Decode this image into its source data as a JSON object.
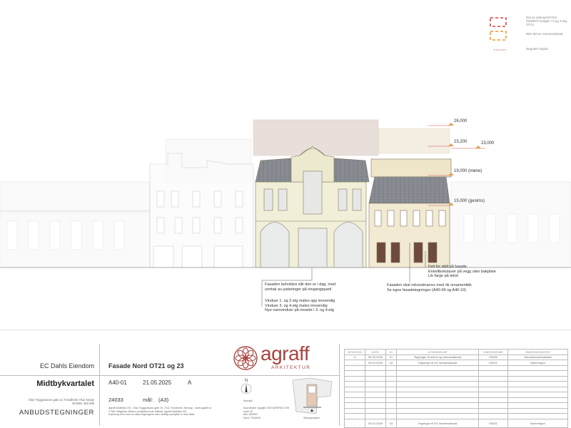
{
  "legend": {
    "item1": "Del av søknad BYGG-25/80970 boliger i 3.og 4.etg. OT21",
    "item2": "Ikke del av rammesøknad",
    "item3": "Regulert høyde"
  },
  "elevations": {
    "e1": "26,000",
    "e2": "23,200",
    "e3": "23,000",
    "e4": "19,000 (møne)",
    "e5": "15,000 (gesims)"
  },
  "notes": {
    "sign": [
      "Felt for skilt på fasade.",
      "Enkeltbokstaver på vegg uten bakplate",
      "Lik farge på tekst"
    ],
    "ot23": [
      "Fasaden skal rekonstrueres med rik ornamentikk",
      "Se egne fasadetegninger (A40-09 og A40-10)"
    ],
    "ot21": [
      "Fasaden beholdes slik den er i dag, med",
      "unntak av justeringer på inngangsparti"
    ],
    "windows": [
      "Vinduer 1. og 2.etg males opp innvendig",
      "Vinduer 3. og 4.etg males innvendig",
      "Nye varevinduer på innside i 3. og 4.etg"
    ]
  },
  "titleblock": {
    "client": "EC Dahls Eiendom",
    "project": "Midtbykvartalet",
    "address": [
      "Olav Tryggvasons gate 21 Trondheim 7011 Norge",
      "Gnr/Bnr 401/189"
    ],
    "phase": "ANBUDSTEGNINGER",
    "drawing_title": "Fasade Nord OT21 og 23",
    "drawing_no": "A40-01",
    "date": "21.05.2025",
    "revision": "A",
    "project_no": "24033",
    "scale_label": "mål:",
    "scale": "(A3)",
    "firm_lines": [
      "Agraff Arkitektur AS - Olav Tryggvasons gate 19, 7011 Trondheim, Norway - www.agraff.no",
      "© Alle rettigheter tilhører prosjekterende arkitekt, Agraff Arkitektur AS.",
      "Kopiering eller bruk av disse tegningene uten skriftlig samtykke er ikke tillatt."
    ],
    "brand": "agraff",
    "brand_sub": "ARKITEKTUR",
    "north_label": "Nordpil",
    "coords": [
      "Koordinater oppgitt i NS EUREF89 UTM sone 32",
      "Øst: 569900",
      "Nord: 7034349"
    ],
    "keyplan_label": "Situasjonsplan"
  },
  "revisions": {
    "headers": [
      "REVISJON",
      "DATO",
      "ID",
      "UTSENDELSE",
      "ENDRINGSNR",
      "ENDRINGSNOTAT"
    ],
    "rows": [
      [
        "A",
        "06.05.2025",
        "07",
        "Tegninger til anbud og rammesøknad",
        "FA006",
        "Anbud/rammesøknad"
      ],
      [
        "-",
        "03.02.2025",
        "03",
        "Tegninger til KS rammesøknad",
        "FA001",
        "Nullrevisjon"
      ],
      [
        "",
        "",
        "",
        "",
        "",
        ""
      ],
      [
        "",
        "",
        "",
        "",
        "",
        ""
      ],
      [
        "",
        "",
        "",
        "",
        "",
        ""
      ],
      [
        "",
        "",
        "",
        "",
        "",
        ""
      ],
      [
        "",
        "",
        "",
        "",
        "",
        ""
      ],
      [
        "",
        "",
        "",
        "",
        "",
        ""
      ],
      [
        "",
        "",
        "",
        "",
        "",
        ""
      ],
      [
        "",
        "",
        "",
        "",
        "",
        ""
      ],
      [
        "",
        "",
        "",
        "",
        "",
        ""
      ],
      [
        "",
        "",
        "",
        "",
        "",
        ""
      ],
      [
        "-",
        "03.02.2025",
        "03",
        "Tegninger til KS rammesøknad",
        "FA001",
        "Nullrevisjon"
      ]
    ]
  }
}
